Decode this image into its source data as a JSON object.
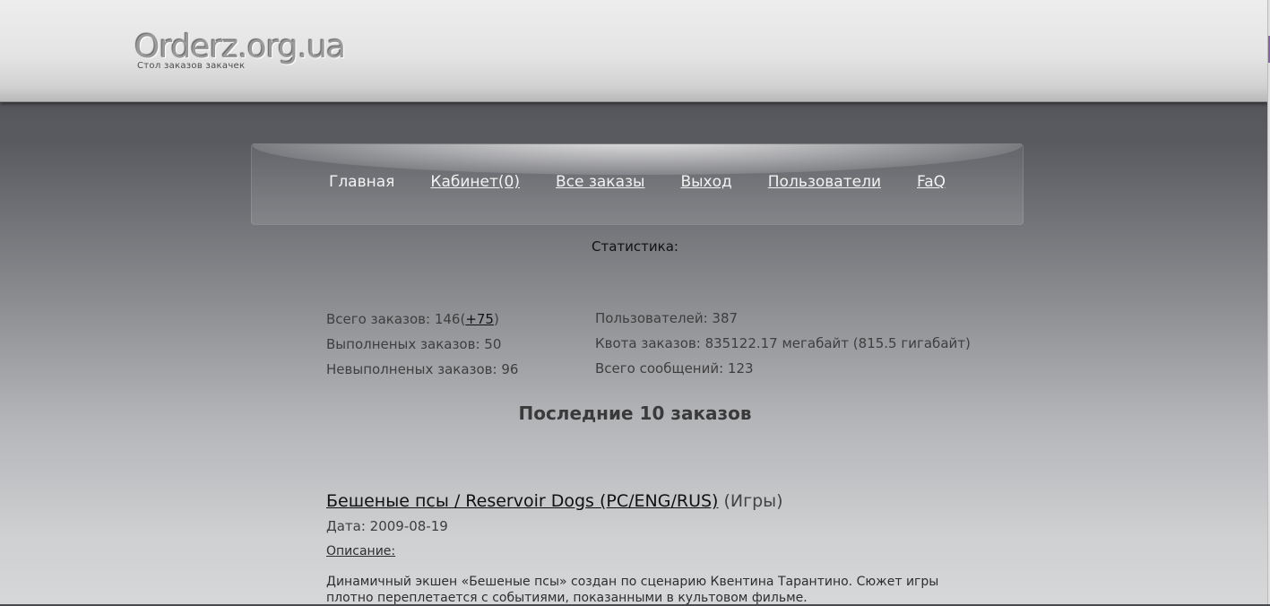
{
  "header": {
    "logo": "Orderz.org.ua",
    "tagline": "Стол заказов закачек"
  },
  "nav": {
    "items": [
      {
        "label": "Главная"
      },
      {
        "label": "Кабинет(0)"
      },
      {
        "label": "Все заказы"
      },
      {
        "label": "Выход"
      },
      {
        "label": "Пользователи"
      },
      {
        "label": "FaQ"
      }
    ]
  },
  "stats": {
    "title": "Статистика:",
    "total_orders_label": "Всего заказов: 146(",
    "total_orders_new": "+75",
    "total_orders_close": ")",
    "completed": "Выполненых заказов: 50",
    "uncompleted": "Невыполненых заказов: 96",
    "users": "Пользователей: 387",
    "quota": "Квота заказов: 835122.17 мегабайт (815.5 гигабайт)",
    "messages": "Всего сообщений: 123"
  },
  "latest": {
    "title": "Последние 10 заказов",
    "orders": [
      {
        "title": "Бешеные псы / Reservoir Dogs (PC/ENG/RUS)",
        "category": "(Игры)",
        "date": "Дата: 2009-08-19",
        "desc_label": "Описание:",
        "desc": "Динамичный экшен «Бешеные псы» создан по сценарию Квентина Тарантино. Сюжет игры плотно переплетается с событиями, показанными в культовом фильме."
      }
    ]
  }
}
